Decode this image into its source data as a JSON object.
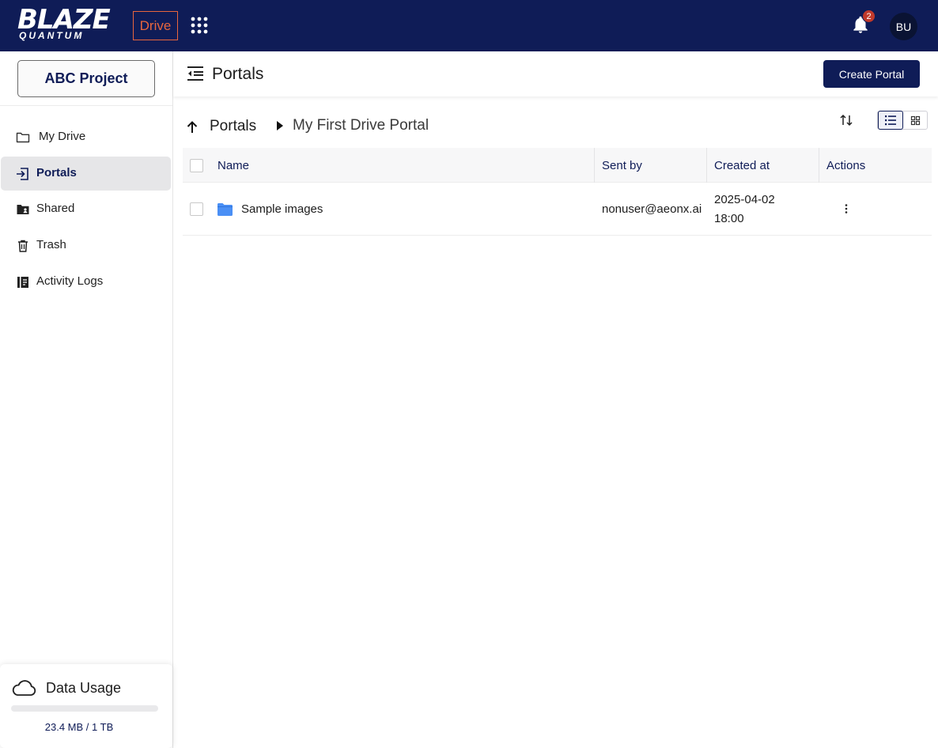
{
  "header": {
    "logo_main": "BLAZE",
    "logo_sub": "QUANTUM",
    "app_badge": "Drive",
    "notification_count": "2",
    "avatar_initials": "BU",
    "icons": {
      "apps": "apps-grid-icon",
      "notifications": "bell-icon"
    },
    "colors": {
      "topbar": "#0f1c57",
      "badge_accent": "#e8663d",
      "notif_badge": "#c0392b"
    }
  },
  "sidebar": {
    "project_button": "ABC Project",
    "items": [
      {
        "label": "My Drive",
        "icon": "folder-icon",
        "active": false
      },
      {
        "label": "Portals",
        "icon": "portal-icon",
        "active": true
      },
      {
        "label": "Shared",
        "icon": "shared-folder-icon",
        "active": false
      },
      {
        "label": "Trash",
        "icon": "trash-icon",
        "active": false
      },
      {
        "label": "Activity Logs",
        "icon": "activity-log-icon",
        "active": false
      }
    ],
    "usage": {
      "title": "Data Usage",
      "text": "23.4 MB / 1 TB",
      "fraction_used": 2.34e-05,
      "icon": "cloud-icon"
    }
  },
  "main": {
    "title": "Portals",
    "create_button": "Create Portal",
    "breadcrumb": {
      "root": "Portals",
      "current": "My First Drive Portal"
    },
    "view_mode": "list",
    "table": {
      "columns": [
        "Name",
        "Sent by",
        "Created at",
        "Actions"
      ],
      "rows": [
        {
          "name": "Sample images",
          "sent_by": "nonuser@aeonx.ai",
          "created_date": "2025-04-02",
          "created_time": "18:00",
          "icon": "folder-icon"
        }
      ]
    },
    "colors": {
      "primary": "#0f1c57",
      "folder": "#4a8ff5",
      "active_nav_bg": "#e6e6e8"
    }
  }
}
